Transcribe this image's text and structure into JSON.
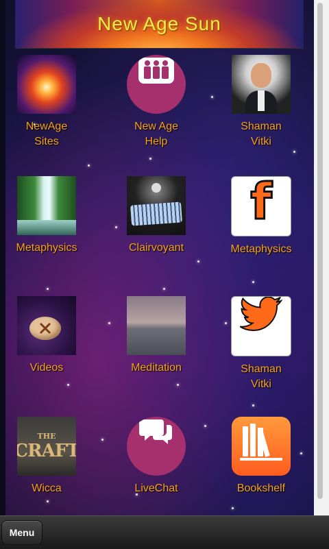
{
  "banner": {
    "title": "New Age Sun"
  },
  "tiles": [
    {
      "line1": "NewAge",
      "line2": "Sites",
      "icon": "sun-flare-photo"
    },
    {
      "line1": "New Age",
      "line2": "Help",
      "icon": "people-group-icon"
    },
    {
      "line1": "Shaman",
      "line2": "Vitki",
      "icon": "portrait-photo"
    },
    {
      "line1": "Metaphysics",
      "line2": "",
      "icon": "waterfall-photo"
    },
    {
      "line1": "Clairvoyant",
      "line2": "",
      "icon": "tarot-cards-photo"
    },
    {
      "line1": "Metaphysics",
      "line2": "",
      "icon": "facebook-icon"
    },
    {
      "line1": "Videos",
      "line2": "",
      "icon": "rune-stone-photo"
    },
    {
      "line1": "Meditation",
      "line2": "",
      "icon": "seascape-photo"
    },
    {
      "line1": "Shaman",
      "line2": "Vitki",
      "icon": "twitter-bird-icon"
    },
    {
      "line1": "Wicca",
      "line2": "",
      "icon": "the-craft-poster"
    },
    {
      "line1": "LiveChat",
      "line2": "",
      "icon": "chat-bubbles-icon"
    },
    {
      "line1": "Bookshelf",
      "line2": "",
      "icon": "bookshelf-icon"
    }
  ],
  "fb_letter": "f",
  "craft_text": {
    "line1": "THE",
    "line2": "CRAFT"
  },
  "bottom_bar": {
    "menu_label": "Menu"
  },
  "colors": {
    "label": "#f7a21b",
    "round_icon_bg": "#a62f6e",
    "banner_text": "#f6e84a"
  }
}
